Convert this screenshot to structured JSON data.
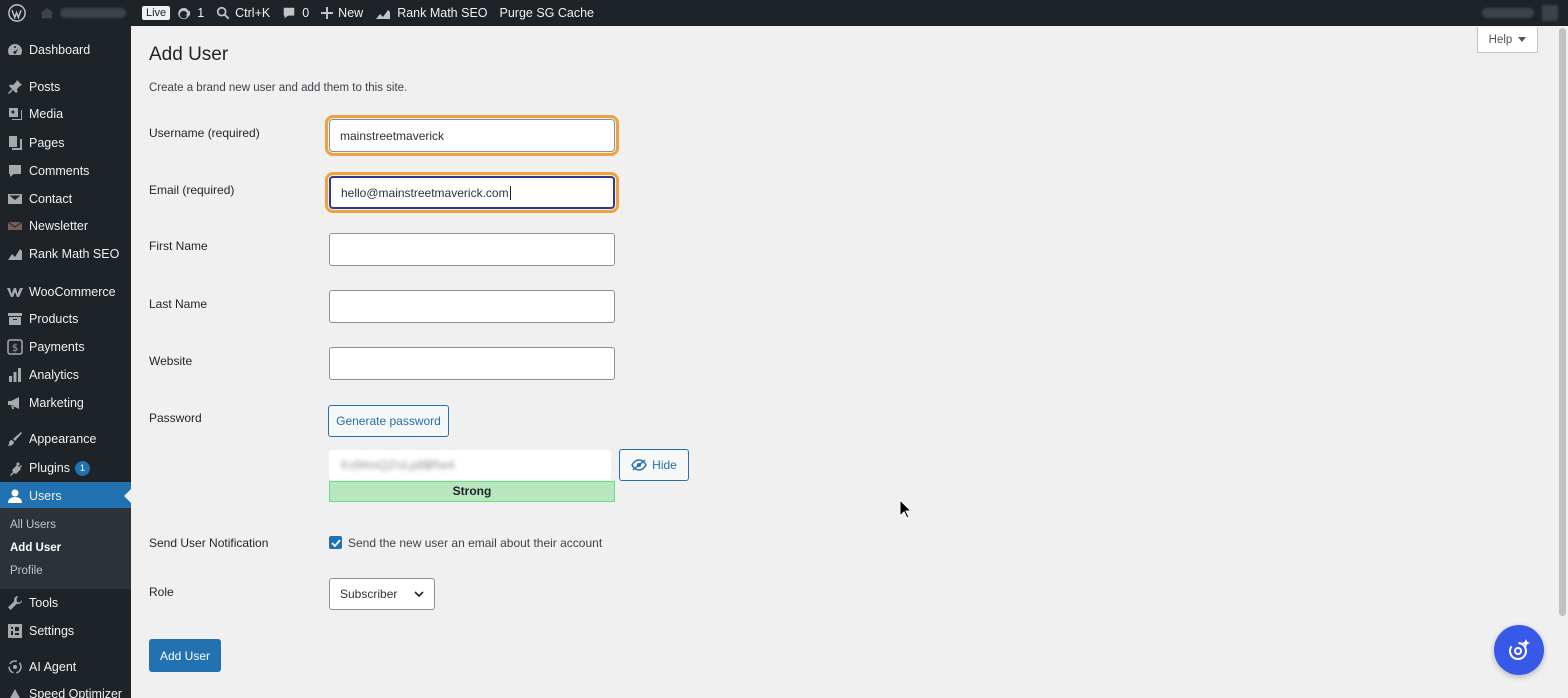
{
  "adminbar": {
    "live": "Live",
    "updates": "1",
    "search": "Ctrl+K",
    "comments": "0",
    "new": "New",
    "rankmath": "Rank Math SEO",
    "purge": "Purge SG Cache"
  },
  "sidebar": {
    "items": [
      {
        "label": "Dashboard",
        "icon": "dashboard-icon"
      },
      {
        "label": "Posts",
        "icon": "pin-icon"
      },
      {
        "label": "Media",
        "icon": "media-icon"
      },
      {
        "label": "Pages",
        "icon": "pages-icon"
      },
      {
        "label": "Comments",
        "icon": "comment-icon"
      },
      {
        "label": "Contact",
        "icon": "mail-icon"
      },
      {
        "label": "Newsletter",
        "icon": "newsletter-icon"
      },
      {
        "label": "Rank Math SEO",
        "icon": "rankmath-icon"
      },
      {
        "label": "WooCommerce",
        "icon": "woo-icon"
      },
      {
        "label": "Products",
        "icon": "archive-icon"
      },
      {
        "label": "Payments",
        "icon": "dollar-icon"
      },
      {
        "label": "Analytics",
        "icon": "bar-chart-icon"
      },
      {
        "label": "Marketing",
        "icon": "megaphone-icon"
      },
      {
        "label": "Appearance",
        "icon": "brush-icon"
      },
      {
        "label": "Plugins",
        "icon": "plugin-icon",
        "badge": "1"
      },
      {
        "label": "Users",
        "icon": "user-icon"
      },
      {
        "label": "Tools",
        "icon": "wrench-icon"
      },
      {
        "label": "Settings",
        "icon": "settings-icon"
      },
      {
        "label": "AI Agent",
        "icon": "ai-agent-icon"
      },
      {
        "label": "Speed Optimizer",
        "icon": "speed-icon"
      }
    ],
    "submenu": [
      "All Users",
      "Add User",
      "Profile"
    ]
  },
  "page": {
    "title": "Add User",
    "description": "Create a brand new user and add them to this site.",
    "help": "Help"
  },
  "form": {
    "username_label": "Username (required)",
    "username_value": "mainstreetmaverick",
    "email_label": "Email (required)",
    "email_value": "hello@mainstreetmaverick.com",
    "first_name_label": "First Name",
    "last_name_label": "Last Name",
    "website_label": "Website",
    "password_label": "Password",
    "generate_password": "Generate password",
    "password_value": "Kx9#mQ2!vLp8$Rw4",
    "hide": "Hide",
    "strength": "Strong",
    "notification_label": "Send User Notification",
    "notification_text": "Send the new user an email about their account",
    "role_label": "Role",
    "role_value": "Subscriber",
    "submit": "Add User"
  }
}
